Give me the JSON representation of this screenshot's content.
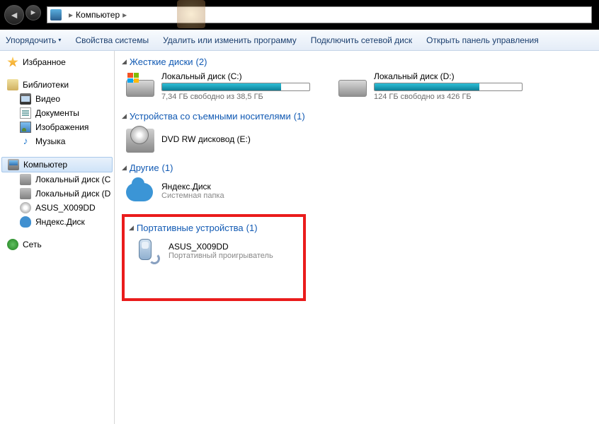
{
  "address": {
    "root": "Компьютер"
  },
  "toolbar": {
    "organize": "Упорядочить",
    "properties": "Свойства системы",
    "uninstall": "Удалить или изменить программу",
    "mapdrive": "Подключить сетевой диск",
    "controlpanel": "Открыть панель управления"
  },
  "sidebar": {
    "favorites": "Избранное",
    "libraries": "Библиотеки",
    "lib_items": {
      "video": "Видео",
      "docs": "Документы",
      "images": "Изображения",
      "music": "Музыка"
    },
    "computer": "Компьютер",
    "comp_items": {
      "c": "Локальный диск (C",
      "d": "Локальный диск (D",
      "asus": "ASUS_X009DD",
      "yadisk": "Яндекс.Диск"
    },
    "network": "Сеть"
  },
  "sections": {
    "hdd": {
      "title": "Жесткие диски",
      "count": "(2)"
    },
    "removable": {
      "title": "Устройства со съемными носителями",
      "count": "(1)"
    },
    "other": {
      "title": "Другие",
      "count": "(1)"
    },
    "portable": {
      "title": "Портативные устройства",
      "count": "(1)"
    }
  },
  "drives": {
    "c": {
      "name": "Локальный диск (C:)",
      "free": "7,34 ГБ свободно из 38,5 ГБ"
    },
    "d": {
      "name": "Локальный диск (D:)",
      "free": "124 ГБ свободно из 426 ГБ"
    }
  },
  "dvd": {
    "name": "DVD RW дисковод (E:)"
  },
  "yadisk": {
    "name": "Яндекс.Диск",
    "sub": "Системная папка"
  },
  "portable_device": {
    "name": "ASUS_X009DD",
    "sub": "Портативный проигрыватель"
  }
}
